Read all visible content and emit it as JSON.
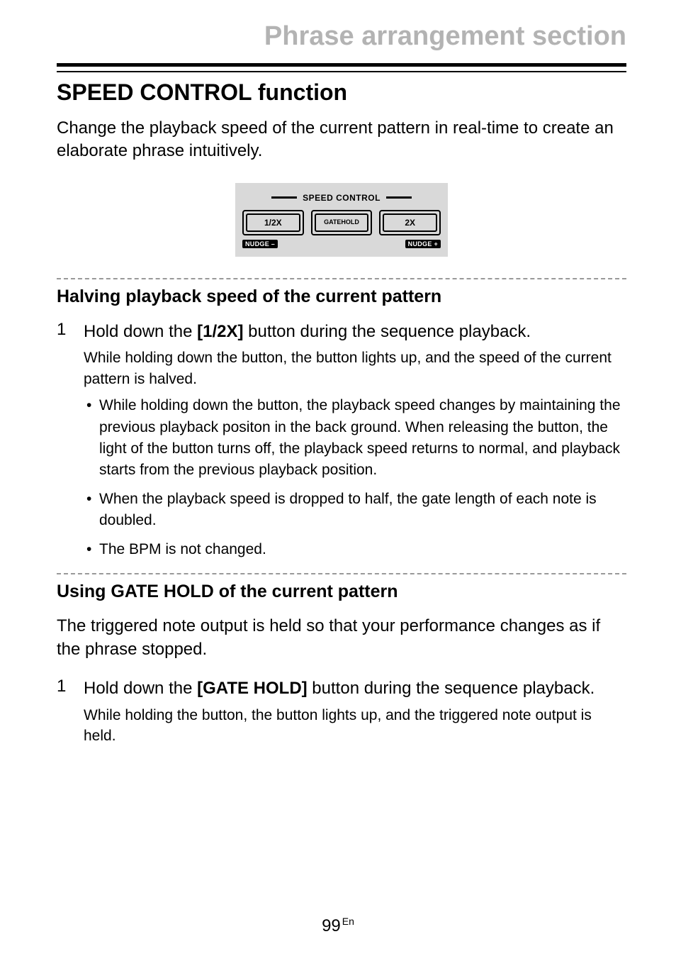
{
  "header": {
    "chapter": "Phrase arrangement section"
  },
  "section": {
    "title": "SPEED CONTROL function",
    "intro": "Change the playback speed of the current pattern in real-time to create an elaborate phrase intuitively."
  },
  "panel": {
    "title": "SPEED CONTROL",
    "btn_half": "1/2X",
    "btn_gate_l1": "GATE",
    "btn_gate_l2": "HOLD",
    "btn_double": "2X",
    "nudge_minus": "NUDGE –",
    "nudge_plus": "NUDGE +"
  },
  "sub1": {
    "title": "Halving playback speed of the current pattern",
    "step1_num": "1",
    "step1_pre": "Hold down the ",
    "step1_bold": "[1/2X]",
    "step1_post": " button during the sequence playback.",
    "step1_sub": "While holding down the button, the button lights up, and the speed of the current pattern is halved.",
    "bullets": [
      "While holding down the button, the playback speed changes by maintaining the previous playback positon in the back ground. When releasing the button, the light of the button turns off, the playback speed returns to normal, and playback starts from the previous playback position.",
      "When the playback speed is dropped to half, the gate length of each note is doubled.",
      "The BPM is not changed."
    ]
  },
  "sub2": {
    "title": "Using GATE HOLD of the current pattern",
    "intro": "The triggered note output is held so that your performance changes as if the phrase stopped.",
    "step1_num": "1",
    "step1_pre": "Hold down the ",
    "step1_bold": "[GATE HOLD]",
    "step1_post": " button during the sequence playback.",
    "step1_sub": "While holding the button, the button lights up, and the triggered note output is held."
  },
  "footer": {
    "page": "99",
    "lang": "En"
  }
}
